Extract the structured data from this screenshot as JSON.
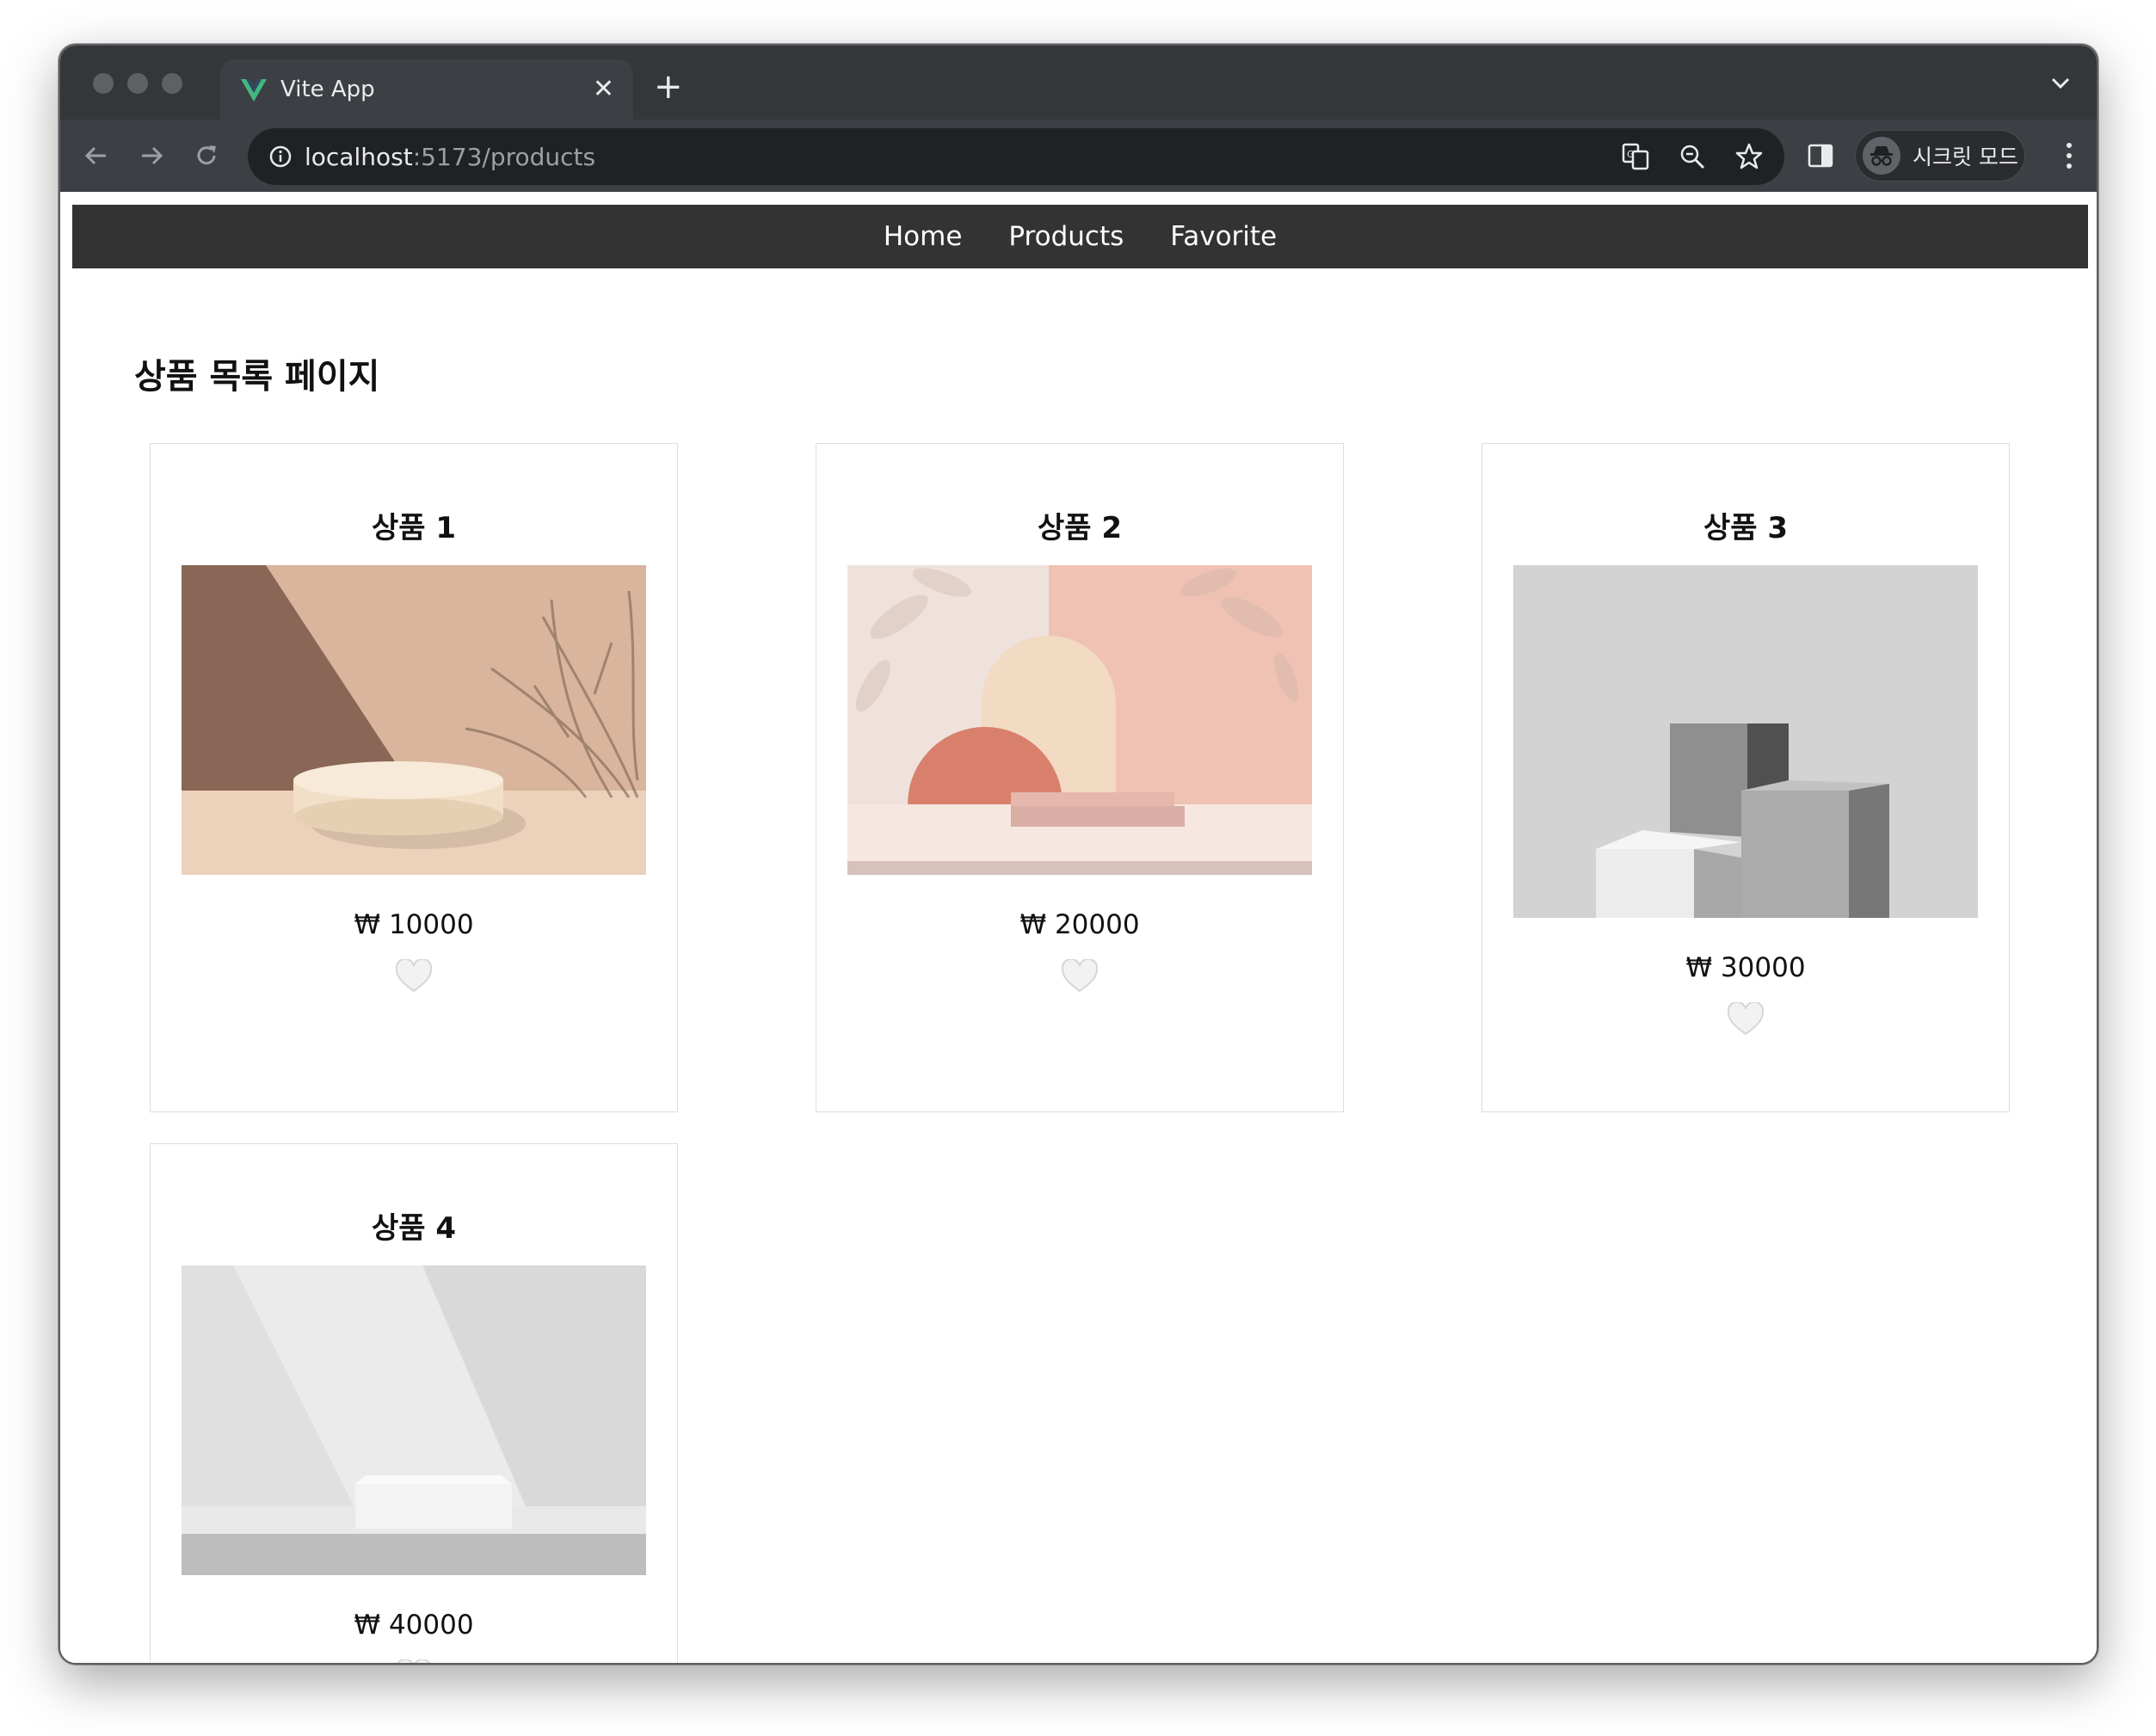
{
  "browser": {
    "tab_title": "Vite App",
    "tab_close": "✕",
    "new_tab": "+",
    "url_host": "localhost",
    "url_path": ":5173/products",
    "profile_label": "시크릿 모드",
    "icons": [
      "back-arrow-icon",
      "forward-arrow-icon",
      "reload-icon",
      "info-icon",
      "translate-icon",
      "zoom-out-icon",
      "bookmark-star-icon",
      "side-panel-icon",
      "incognito-icon",
      "kebab-menu-icon",
      "tab-search-chevron-icon",
      "vite-logo-icon"
    ]
  },
  "nav": {
    "home": "Home",
    "products": "Products",
    "favorite": "Favorite"
  },
  "page": {
    "title": "상품 목록 페이지"
  },
  "products": [
    {
      "name": "상품 1",
      "price": "₩ 10000",
      "favorite": false
    },
    {
      "name": "상품 2",
      "price": "₩ 20000",
      "favorite": false
    },
    {
      "name": "상품 3",
      "price": "₩ 30000",
      "favorite": false
    },
    {
      "name": "상품 4",
      "price": "₩ 40000",
      "favorite": false
    }
  ],
  "colors": {
    "chrome_tabstrip": "#35363a",
    "chrome_toolbar": "#3c3f43",
    "omnibox": "#202124",
    "site_nav": "#333333",
    "vite_green": "#41b883"
  }
}
